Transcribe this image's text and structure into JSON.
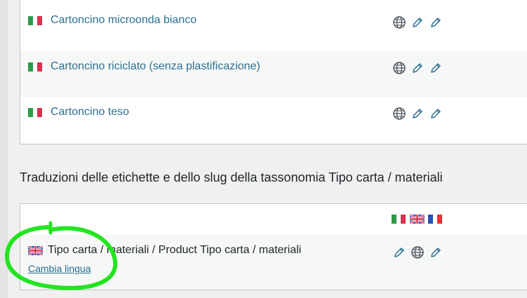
{
  "terms": [
    {
      "name": "Cartoncino microonda bianco",
      "flag": "it"
    },
    {
      "name": "Cartoncino riciclato (senza plastificazione)",
      "flag": "it"
    },
    {
      "name": "Cartoncino teso",
      "flag": "it"
    }
  ],
  "section_heading": "Traduzioni delle etichette e dello slug della tassonomia Tipo carta / materiali",
  "taxonomy_row": {
    "flag": "en",
    "label": "Tipo carta / materiali / Product Tipo carta / materiali",
    "change_language": "Cambia lingua"
  },
  "language_columns": [
    "it",
    "en",
    "fr"
  ],
  "icons": [
    "globe-icon",
    "pencil-icon",
    "pencil-icon"
  ],
  "colors": {
    "link": "#2b6f91",
    "highlight": "#22e51f",
    "row_alt": "#f6f7f7",
    "border": "#c3c4c7"
  }
}
